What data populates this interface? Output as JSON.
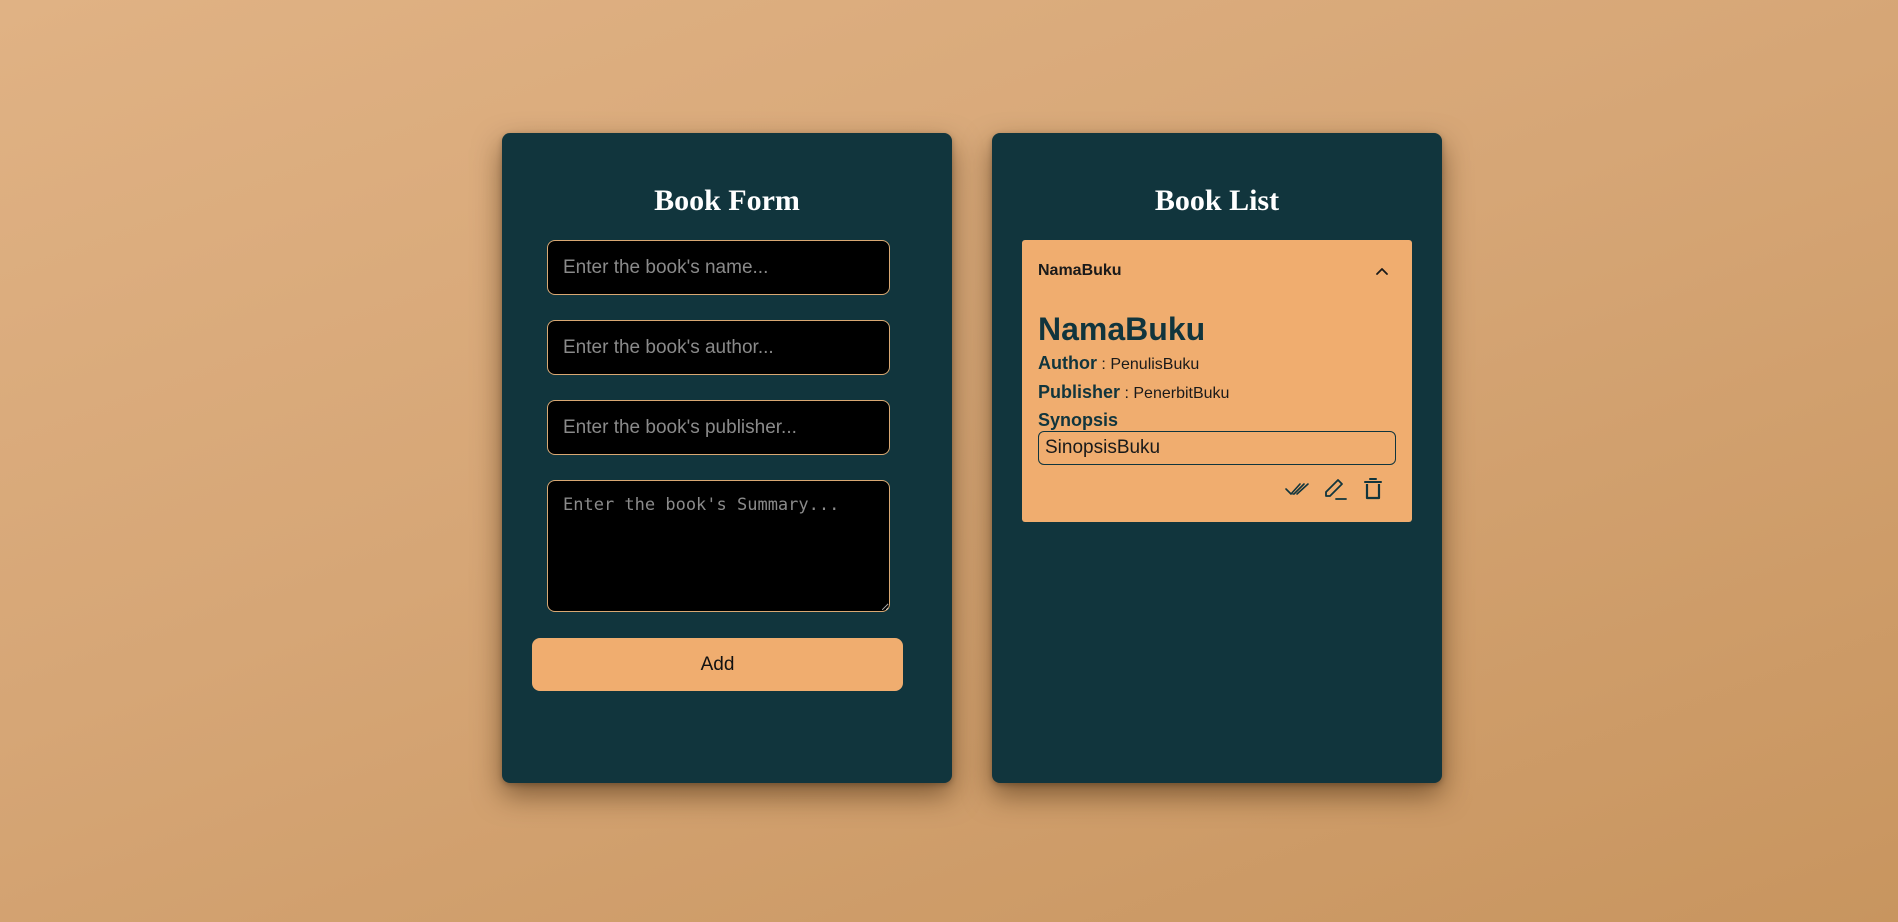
{
  "form": {
    "title": "Book Form",
    "name_placeholder": "Enter the book's name...",
    "author_placeholder": "Enter the book's author...",
    "publisher_placeholder": "Enter the book's publisher...",
    "summary_placeholder": "Enter the book's Summary...",
    "add_label": "Add"
  },
  "list": {
    "title": "Book List",
    "books": [
      {
        "header": "NamaBuku",
        "name": "NamaBuku",
        "author_label": "Author",
        "author_value": " : PenulisBuku",
        "publisher_label": "Publisher",
        "publisher_value": " : PenerbitBuku",
        "synopsis_label": "Synopsis",
        "synopsis_value": "SinopsisBuku",
        "expanded": true,
        "icons": [
          "chevron-up-icon",
          "double-check-icon",
          "pencil-icon",
          "trash-icon"
        ]
      }
    ]
  },
  "colors": {
    "panel": "#11353d",
    "accent": "#f0ad6f",
    "input_bg": "#000000",
    "input_border": "#d9a873"
  }
}
